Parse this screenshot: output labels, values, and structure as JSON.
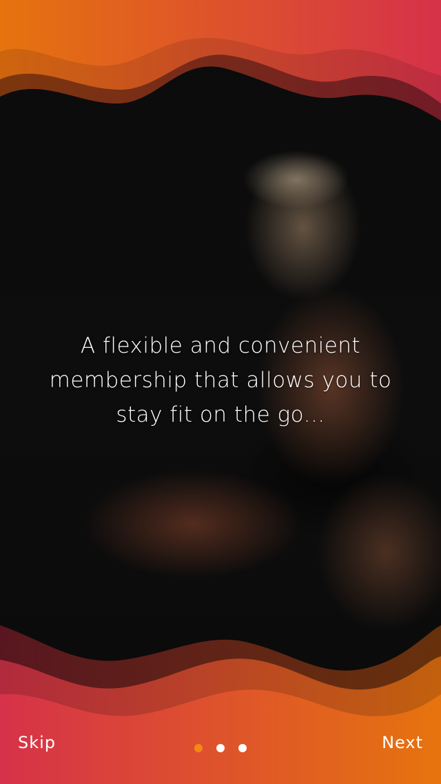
{
  "onboarding": {
    "tagline_line1": "A flexible and convenient",
    "tagline_line2": "membership that allows you to",
    "tagline_line3": "stay fit on the go...",
    "skip_label": "Skip",
    "next_label": "Next",
    "page_count": 3,
    "current_page": 1
  },
  "colors": {
    "wave_orange": "#e8750e",
    "wave_red": "#d8324a",
    "active_dot": "#f28a12",
    "inactive_dot": "#ffffff",
    "text": "#ffffff"
  },
  "background_image": "woman-lifting-dumbbells-photo"
}
